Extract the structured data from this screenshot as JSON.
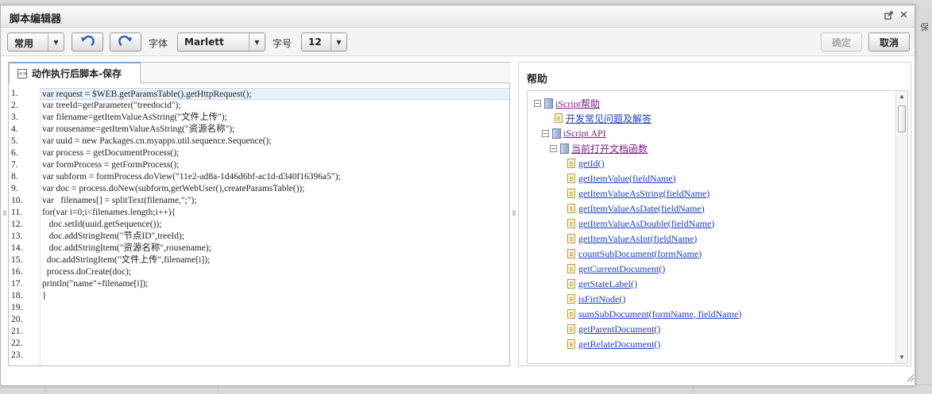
{
  "dialog": {
    "title": "脚本编辑器"
  },
  "toolbar": {
    "mode_value": "常用",
    "font_label": "字体",
    "font_value": "Marlett",
    "size_label": "字号",
    "size_value": "12",
    "confirm_label": "确定",
    "cancel_label": "取消"
  },
  "editor": {
    "tab_label": "动作执行后脚本-保存",
    "lines": [
      "var request = $WEB.getParamsTable().getHttpRequest();",
      "var treeId=getParameter(\"treedocid\");",
      "var filename=getItemValueAsString(\"文件上传\");",
      "var rousename=getItemValueAsString(\"资源名称\");",
      "var uuid = new Packages.cn.myapps.util.sequence.Sequence();",
      "var process = getDocumentProcess();",
      "var formProcess = getFormProcess();",
      "var subform = formProcess.doView(\"11e2-ad8a-1d46d6bf-ac1d-d340f16396a5\");",
      "var doc = process.doNew(subform,getWebUser(),createParamsTable());",
      "var   filenames[] = splitText(filename,\";\");",
      "for(var i=0;i<filenames.length;i++){",
      "   doc.setId(uuid.getSequence());",
      "   doc.addStringItem(\"节点ID\",treeId);",
      "   doc.addStringItem(\"资源名称\",rousename);",
      "  doc.addStringItem(\"文件上传\",filename[i]);",
      "  process.doCreate(doc);",
      "println(\"name\"+filename[i]);",
      "}",
      "",
      "",
      "",
      "",
      ""
    ],
    "line_numbers": [
      "1.",
      "2.",
      "3.",
      "4.",
      "5.",
      "6.",
      "7.",
      "8.",
      "9.",
      "10.",
      "11.",
      "12.",
      "13.",
      "14.",
      "15.",
      "16.",
      "17.",
      "18.",
      "19.",
      "20.",
      "21.",
      "22.",
      "23."
    ]
  },
  "help": {
    "title": "帮助",
    "tree": [
      {
        "label": "iScript帮助",
        "level": 0,
        "kind": "book",
        "expander": "⊟",
        "visited": true
      },
      {
        "label": "开发常见问题及解答",
        "level": 1,
        "kind": "page",
        "expander": "",
        "visited": false
      },
      {
        "label": "iScript API",
        "level": 1,
        "kind": "book",
        "expander": "⊟",
        "visited": true
      },
      {
        "label": "当前打开文档函数",
        "level": 2,
        "kind": "book",
        "expander": "⊟",
        "visited": true
      },
      {
        "label": "getId()",
        "level": 3,
        "kind": "page",
        "expander": "",
        "visited": false
      },
      {
        "label": "getItemValue(fieldName)",
        "level": 3,
        "kind": "page",
        "expander": "",
        "visited": false
      },
      {
        "label": "getItemValueAsString(fieldName)",
        "level": 3,
        "kind": "page",
        "expander": "",
        "visited": false
      },
      {
        "label": "getItemValueAsDate(fieldName)",
        "level": 3,
        "kind": "page",
        "expander": "",
        "visited": false
      },
      {
        "label": "getItemValueAsDouble(fieldName)",
        "level": 3,
        "kind": "page",
        "expander": "",
        "visited": false
      },
      {
        "label": "getItemValueAsInt(fieldName)",
        "level": 3,
        "kind": "page",
        "expander": "",
        "visited": false
      },
      {
        "label": "countSubDocument(formName)",
        "level": 3,
        "kind": "page",
        "expander": "",
        "visited": false
      },
      {
        "label": "getCurrentDocument()",
        "level": 3,
        "kind": "page",
        "expander": "",
        "visited": false
      },
      {
        "label": "getStateLabel()",
        "level": 3,
        "kind": "page",
        "expander": "",
        "visited": false
      },
      {
        "label": "isFirtNode()",
        "level": 3,
        "kind": "page",
        "expander": "",
        "visited": false
      },
      {
        "label": "sumSubDocument(formName, fieldName)",
        "level": 3,
        "kind": "page",
        "expander": "",
        "visited": false
      },
      {
        "label": "getParentDocument()",
        "level": 3,
        "kind": "page",
        "expander": "",
        "visited": false
      },
      {
        "label": "getRelateDocument()",
        "level": 3,
        "kind": "page",
        "expander": "",
        "visited": false
      }
    ]
  },
  "background": {
    "right_label": "保"
  }
}
